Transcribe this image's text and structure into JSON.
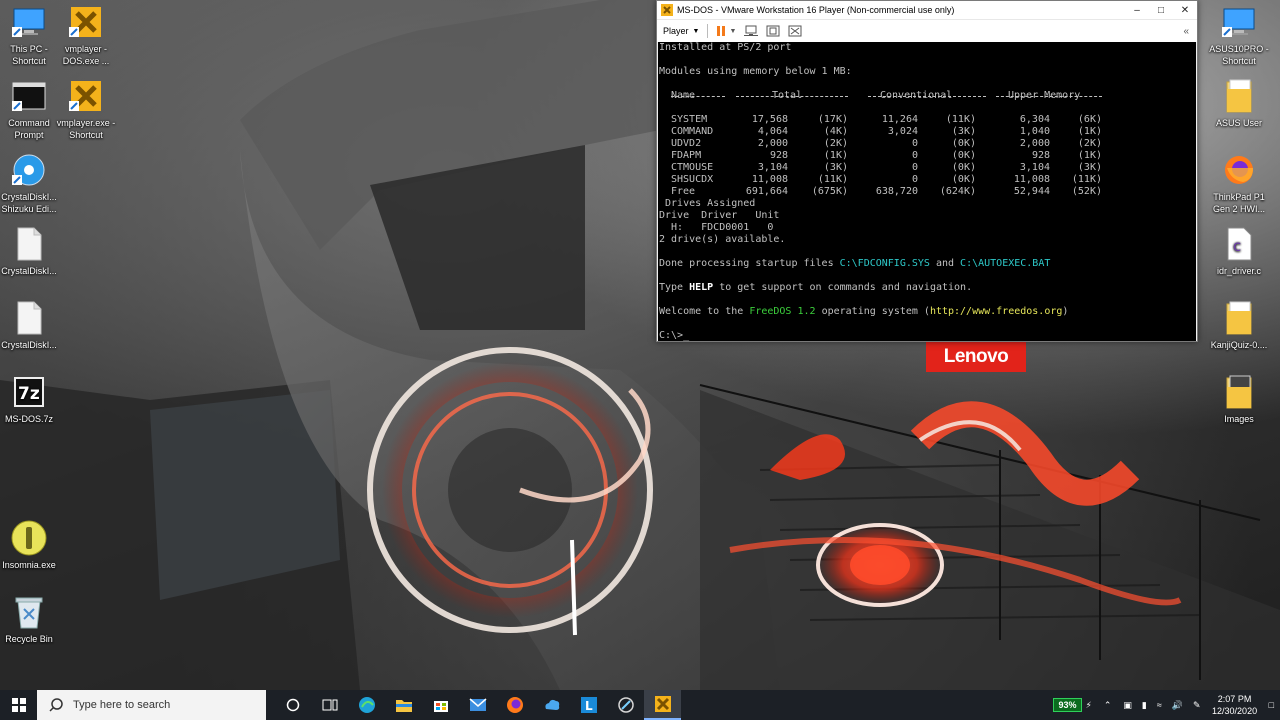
{
  "desktop": {
    "icons_left": [
      {
        "label": "This PC - Shortcut",
        "icon": "pc-icon"
      },
      {
        "label": "vmplayer - DOS.exe ...",
        "icon": "vmware-icon"
      },
      {
        "label": "Command Prompt",
        "icon": "terminal-icon"
      },
      {
        "label": "vmplayer.exe - Shortcut",
        "icon": "vmware-icon"
      },
      {
        "label": "CrystalDiskI... Shizuku Edi...",
        "icon": "disk-icon"
      },
      {
        "label": "CrystalDiskI...",
        "icon": "file-icon"
      },
      {
        "label": "CrystalDiskI...",
        "icon": "file-icon"
      },
      {
        "label": "MS-DOS.7z",
        "icon": "archive-icon"
      },
      {
        "label": "Insomnia.exe",
        "icon": "insomnia-icon"
      },
      {
        "label": "Recycle Bin",
        "icon": "recycle-bin-icon"
      }
    ],
    "icons_right": [
      {
        "label": "ASUS10PRO - Shortcut",
        "icon": "pc-icon"
      },
      {
        "label": "ASUS User",
        "icon": "folder-icon"
      },
      {
        "label": "ThinkPad P1 Gen 2 HWI...",
        "icon": "firefox-icon"
      },
      {
        "label": "idr_driver.c",
        "icon": "c-file-icon"
      },
      {
        "label": "KanjiQuiz-0....",
        "icon": "folder-icon"
      },
      {
        "label": "Images",
        "icon": "folder-icon"
      }
    ],
    "brand_logo": "Lenovo"
  },
  "window": {
    "title": "MS-DOS - VMware Workstation 16 Player (Non-commercial use only)",
    "toolbar": {
      "player_menu": "Player"
    },
    "console": {
      "line_installed": "Installed at PS/2 port",
      "line_modules": "Modules using memory below 1 MB:",
      "table": {
        "headers": [
          "Name",
          "Total",
          "Conventional",
          "Upper Memory"
        ],
        "rows": [
          [
            "SYSTEM",
            "17,568",
            "(17K)",
            "11,264",
            "(11K)",
            "6,304",
            "(6K)"
          ],
          [
            "COMMAND",
            "4,064",
            "(4K)",
            "3,024",
            "(3K)",
            "1,040",
            "(1K)"
          ],
          [
            "UDVD2",
            "2,000",
            "(2K)",
            "0",
            "(0K)",
            "2,000",
            "(2K)"
          ],
          [
            "FDAPM",
            "928",
            "(1K)",
            "0",
            "(0K)",
            "928",
            "(1K)"
          ],
          [
            "CTMOUSE",
            "3,104",
            "(3K)",
            "0",
            "(0K)",
            "3,104",
            "(3K)"
          ],
          [
            "SHSUCDX",
            "11,008",
            "(11K)",
            "0",
            "(0K)",
            "11,008",
            "(11K)"
          ],
          [
            "Free",
            "691,664",
            "(675K)",
            "638,720",
            "(624K)",
            "52,944",
            "(52K)"
          ]
        ]
      },
      "line_drives_assigned": " Drives Assigned",
      "line_drive_header": "Drive  Driver   Unit",
      "line_drive_row": "  H:   FDCD0001   0",
      "line_drives_available": "2 drive(s) available.",
      "line_done_prefix": "Done processing startup files ",
      "line_done_file1": "C:\\FDCONFIG.SYS",
      "line_done_and": " and ",
      "line_done_file2": "C:\\AUTOEXEC.BAT",
      "line_type_prefix": "Type ",
      "line_type_help": "HELP",
      "line_type_suffix": " to get support on commands and navigation.",
      "line_welcome_prefix": "Welcome to the ",
      "line_welcome_os": "FreeDOS 1.2",
      "line_welcome_mid": " operating system (",
      "line_welcome_url": "http://www.freedos.org",
      "line_welcome_end": ")",
      "prompt": "C:\\>_"
    }
  },
  "taskbar": {
    "search_placeholder": "Type here to search",
    "battery": "93%",
    "time": "2:07 PM",
    "date": "12/30/2020"
  },
  "colors": {
    "dos_cyan": "#2ec9c9",
    "dos_green": "#3ccf3c",
    "dos_yellow": "#e6e65a",
    "lenovo_red": "#e2231a",
    "taskbar_bg": "#1c2026"
  }
}
